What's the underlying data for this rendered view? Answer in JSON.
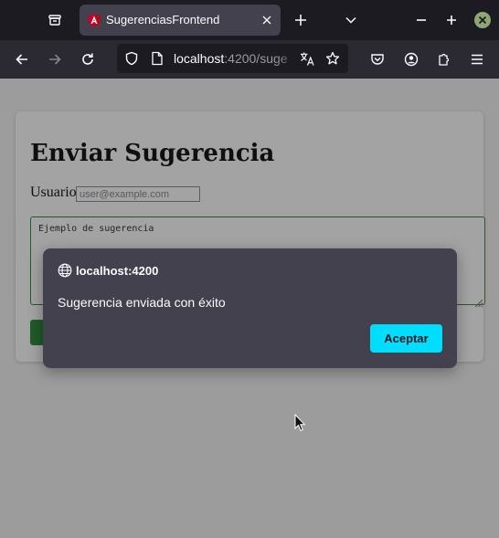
{
  "browser": {
    "tab_title": "SugerenciasFrontend",
    "url_host": "localhost",
    "url_rest": ":4200/suge"
  },
  "page": {
    "title": "Enviar Sugerencia",
    "user_label": "Usuario",
    "user_placeholder": "user@example.com",
    "suggestion_placeholder": "Ejemplo de sugerencia",
    "submit_label": ""
  },
  "dialog": {
    "origin": "localhost:4200",
    "message": "Sugerencia enviada con éxito",
    "accept_label": "Aceptar"
  },
  "colors": {
    "accent": "#00ddff",
    "primary_button": "#2e8b3a",
    "dialog_bg": "#42414d",
    "toolbar_bg": "#2b2a33"
  },
  "icons": [
    "tab-overview-icon",
    "favicon-icon",
    "close-icon",
    "new-tab-icon",
    "chevron-down-icon",
    "minimize-icon",
    "maximize-icon",
    "window-close-icon",
    "back-icon",
    "forward-icon",
    "reload-icon",
    "shield-icon",
    "page-icon",
    "translate-icon",
    "star-icon",
    "pocket-icon",
    "account-icon",
    "extensions-icon",
    "menu-icon",
    "globe-icon"
  ]
}
